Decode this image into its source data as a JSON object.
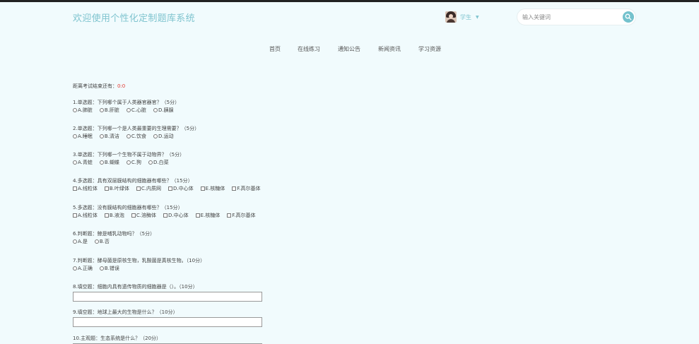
{
  "header": {
    "site_title": "欢迎使用个性化定制题库系统",
    "user_label": "学生",
    "search_placeholder": "输入关键词"
  },
  "nav": [
    "首页",
    "在线练习",
    "通知公告",
    "新闻资讯",
    "学习资源"
  ],
  "exam": {
    "countdown_label": "距离考试结束还有：",
    "countdown_value": "0:0",
    "questions": [
      {
        "title": "1.单选题：下列哪个属于人类器官器官？（5分）",
        "type": "radio",
        "options": [
          "A.肺脏",
          "B.肝脏",
          "C.心脏",
          "D.胰腺"
        ]
      },
      {
        "title": "2.单选题：下列哪一个是人类最重要的生理需要？（5分）",
        "type": "radio",
        "options": [
          "A.睡眠",
          "B.清洁",
          "C.饮食",
          "D.运动"
        ]
      },
      {
        "title": "3.单选题：下列哪一个生物不属于动物界？（5分）",
        "type": "radio",
        "options": [
          "A.青蛙",
          "B.蝴蝶",
          "C.狗",
          "D.白菜"
        ]
      },
      {
        "title": "4.多选题：具有双层膜结构的细胞器有哪些？（15分）",
        "type": "checkbox",
        "options": [
          "A.线粒体",
          "B.叶绿体",
          "C.内质网",
          "D.中心体",
          "E.核糖体",
          "F.高尔基体"
        ]
      },
      {
        "title": "5.多选题：没有膜结构的细胞器有哪些？（15分）",
        "type": "checkbox",
        "options": [
          "A.线粒体",
          "B.液泡",
          "C.溶酶体",
          "D.中心体",
          "E.核糖体",
          "F.高尔基体"
        ]
      },
      {
        "title": "6.判断题：鲸是哺乳动物吗？（5分）",
        "type": "radio",
        "options": [
          "A.是",
          "B.否"
        ]
      },
      {
        "title": "7.判断题：酵母菌是原核生物，乳酸菌是真核生物。（10分）",
        "type": "radio",
        "options": [
          "A.正确",
          "B.错误"
        ]
      },
      {
        "title": "8.填空题：细胞内具有遗传物质的细胞器是（）。（10分）",
        "type": "fill"
      },
      {
        "title": "9.填空题：地球上最大的生物是什么？（10分）",
        "type": "fill"
      },
      {
        "title": "10.主观题：生态系统是什么？（20分）",
        "type": "fill"
      }
    ]
  }
}
